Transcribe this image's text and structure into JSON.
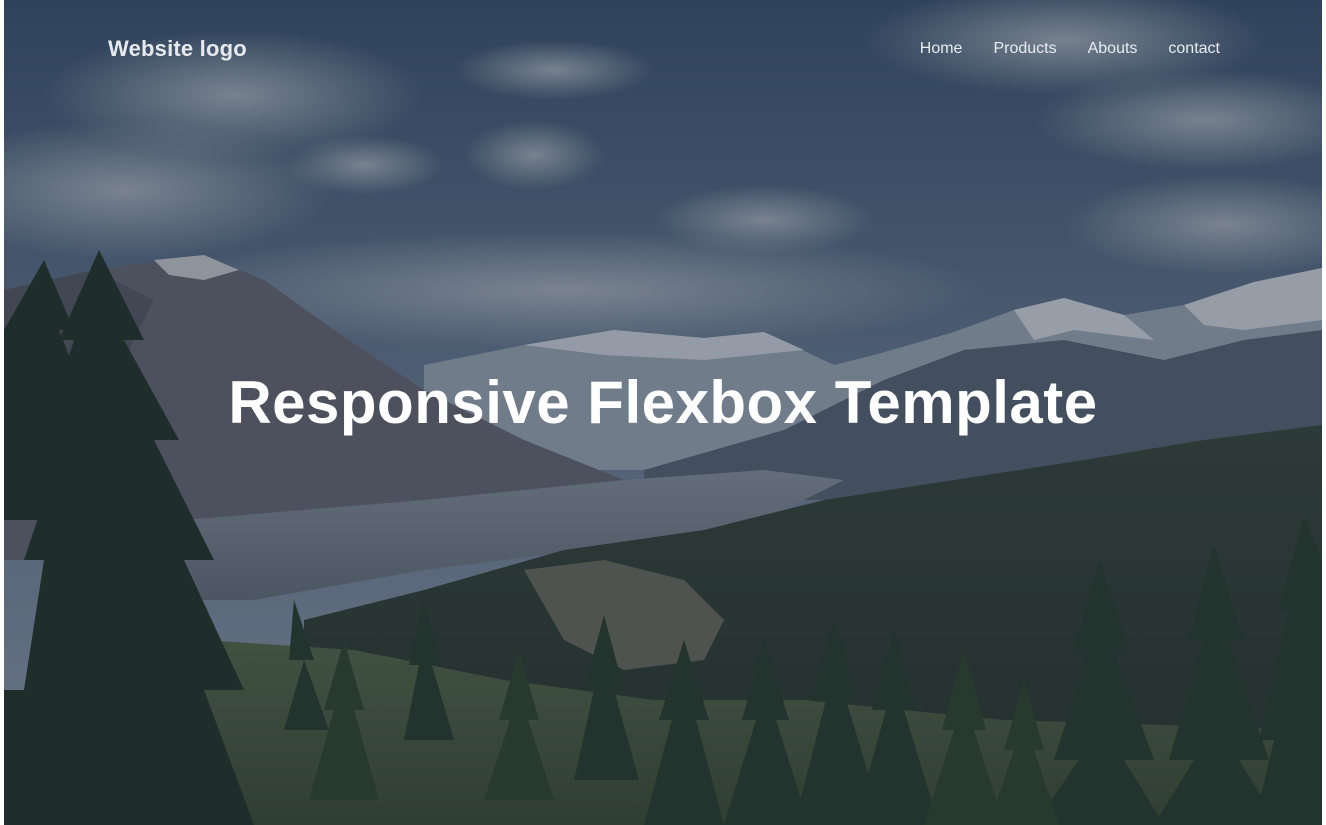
{
  "header": {
    "logo_text": "Website logo",
    "nav": [
      {
        "label": "Home"
      },
      {
        "label": "Products"
      },
      {
        "label": "Abouts"
      },
      {
        "label": "contact"
      }
    ]
  },
  "hero": {
    "title": "Responsive Flexbox Template",
    "background": "mountain-forest-landscape-photo"
  },
  "colors": {
    "overlay": "#1e2a3a",
    "text": "#ffffff"
  }
}
